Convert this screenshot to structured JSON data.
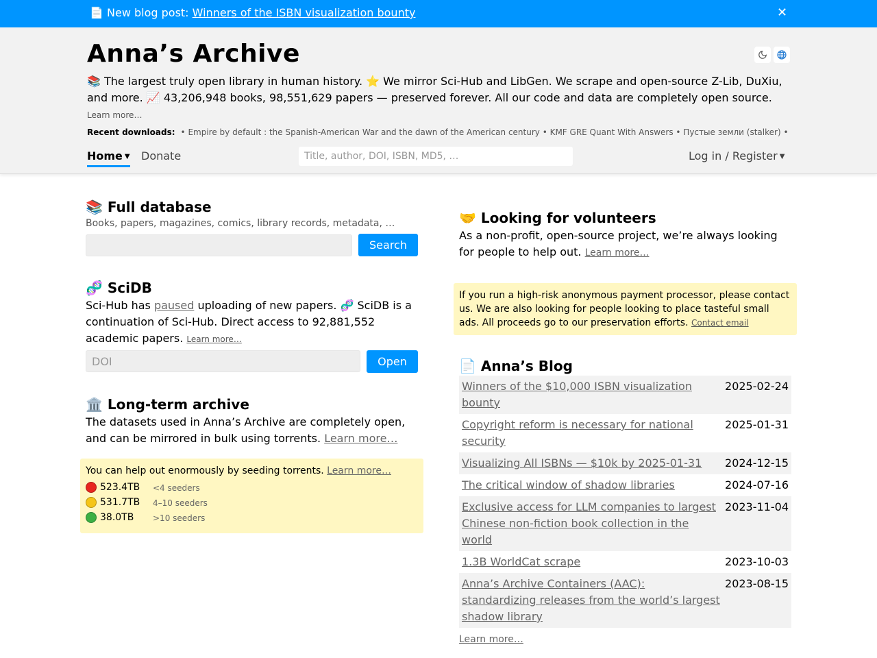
{
  "banner": {
    "prefix": "📄 New blog post: ",
    "link": "Winners of the ISBN visualization bounty",
    "close": "✕"
  },
  "header": {
    "title": "Anna’s Archive",
    "tagline": "📚 The largest truly open library in human history. ⭐️ We mirror Sci-Hub and LibGen. We scrape and open-source Z-Lib, DuXiu, and more. 📈 43,206,948 books, 98,551,629 papers — preserved forever. All our code and data are completely open source.",
    "learn_more": "Learn more…",
    "recent_label": "Recent downloads:",
    "recent_items": "• Empire by default : the Spanish-American War and the dawn of the American century • KMF GRE Quant With Answers • Пустые земли (stalker) •",
    "icons": [
      "moon-icon",
      "globe-icon"
    ]
  },
  "nav": {
    "home": "Home",
    "donate": "Donate",
    "search_placeholder": "Title, author, DOI, ISBN, MD5, …",
    "login": "Log in / Register"
  },
  "full_db": {
    "title": "📚 Full database",
    "subtitle": "Books, papers, magazines, comics, library records, metadata, …",
    "search_value": "",
    "button": "Search"
  },
  "scidb": {
    "title": "🧬 SciDB",
    "text_a": "Sci-Hub has ",
    "paused": "paused",
    "text_b": " uploading of new papers. 🧬 SciDB is a continuation of Sci-Hub. Direct access to 92,881,552 academic papers. ",
    "learn_more": "Learn more…",
    "doi_placeholder": "DOI",
    "button": "Open"
  },
  "archive": {
    "title": "🏛️ Long-term archive",
    "text": "The datasets used in Anna’s Archive are completely open, and can be mirrored in bulk using torrents. ",
    "learn_more": "Learn more…"
  },
  "torrents": {
    "intro": "You can help out enormously by seeding torrents. ",
    "learn_more": "Learn more…",
    "rows": [
      {
        "size": "523.4TB",
        "seeders": "<4 seeders",
        "color": "#e8261f"
      },
      {
        "size": "531.7TB",
        "seeders": "4–10 seeders",
        "color": "#f5c518"
      },
      {
        "size": "38.0TB",
        "seeders": ">10 seeders",
        "color": "#3cb043"
      }
    ]
  },
  "volunteers": {
    "title": "🤝 Looking for volunteers",
    "text": "As a non-profit, open-source project, we’re always looking for people to help out. ",
    "learn_more": "Learn more…"
  },
  "alert": {
    "text": "If you run a high-risk anonymous payment processor, please contact us. We are also looking for people looking to place tasteful small ads. All proceeds go to our preservation efforts. ",
    "link": "Contact email"
  },
  "blog": {
    "title": "📄 Anna’s Blog",
    "posts": [
      {
        "title": "Winners of the $10,000 ISBN visualization bounty",
        "date": "2025-02-24"
      },
      {
        "title": "Copyright reform is necessary for national security",
        "date": "2025-01-31"
      },
      {
        "title": "Visualizing All ISBNs — $10k by 2025-01-31",
        "date": "2024-12-15"
      },
      {
        "title": "The critical window of shadow libraries",
        "date": "2024-07-16"
      },
      {
        "title": "Exclusive access for LLM companies to largest Chinese non-fiction book collection in the world",
        "date": "2023-11-04"
      },
      {
        "title": "1.3B WorldCat scrape",
        "date": "2023-10-03"
      },
      {
        "title": "Anna’s Archive Containers (AAC): standardizing releases from the world’s largest shadow library",
        "date": "2023-08-15"
      }
    ],
    "learn_more": "Learn more…"
  },
  "colors": {
    "accent": "#0095ff",
    "header_bg": "#f2f2f2",
    "notice_bg": "#fff7c2"
  }
}
